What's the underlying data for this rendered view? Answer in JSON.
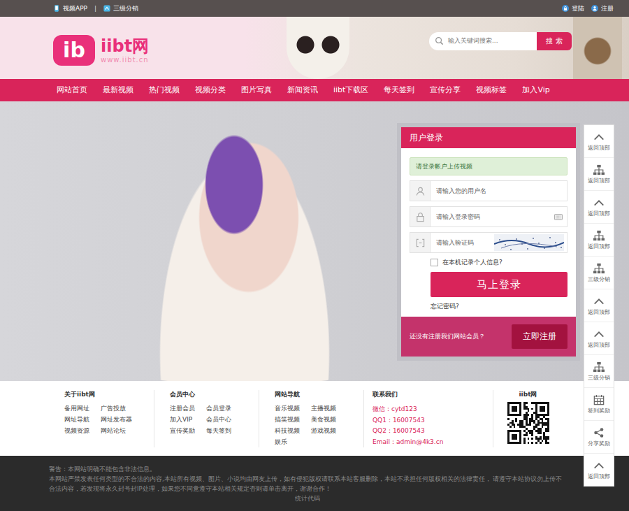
{
  "topbar": {
    "left": [
      {
        "label": "视频APP"
      },
      {
        "label": "三级分销"
      }
    ],
    "separator": "|",
    "right": [
      {
        "label": "登陆"
      },
      {
        "label": "注册"
      }
    ]
  },
  "logo": {
    "mark": "ib",
    "name": "iibt网",
    "url": "www.iibt.cn"
  },
  "search": {
    "placeholder": "输入关键词搜索...",
    "button": "搜 索"
  },
  "nav": [
    {
      "label": "网站首页",
      "selected": false
    },
    {
      "label": "最新视频",
      "selected": false
    },
    {
      "label": "热门视频",
      "selected": false
    },
    {
      "label": "视频分类",
      "selected": false
    },
    {
      "label": "图片写真",
      "selected": false
    },
    {
      "label": "新闻资讯",
      "selected": false
    },
    {
      "label": "iibt下载区",
      "selected": false
    },
    {
      "label": "每天签到",
      "selected": false
    },
    {
      "label": "宣传分享",
      "selected": false
    },
    {
      "label": "视频标签",
      "selected": false
    },
    {
      "label": "加入Vip",
      "selected": false
    }
  ],
  "login": {
    "title": "用户登录",
    "notice": "请登录帐户上传视频",
    "fields": [
      {
        "kind": "text",
        "placeholder": "请输入您的用户名"
      },
      {
        "kind": "password",
        "placeholder": "请输入登录密码"
      },
      {
        "kind": "captcha",
        "placeholder": "请输入验证码"
      }
    ],
    "remember": {
      "label": "在本机记录个人信息?",
      "checked": false
    },
    "submit": "马上登录",
    "forgot": "忘记密码?",
    "register_prompt": "还没有注册我们网站会员？",
    "register_button": "立即注册"
  },
  "sidebar": [
    {
      "kind": "top",
      "label": "返回顶部"
    },
    {
      "kind": "tree",
      "label": "返回顶部"
    },
    {
      "kind": "top",
      "label": "返回顶部"
    },
    {
      "kind": "tree",
      "label": "返回顶部"
    },
    {
      "kind": "tree",
      "label": "三级分销"
    },
    {
      "kind": "top",
      "label": "返回顶部"
    },
    {
      "kind": "top",
      "label": "返回顶部"
    },
    {
      "kind": "tree",
      "label": "三级分销"
    },
    {
      "kind": "calendar",
      "label": "签到奖励"
    },
    {
      "kind": "share",
      "label": "分享奖励"
    },
    {
      "kind": "top",
      "label": "返回顶部"
    }
  ],
  "footer": {
    "columns": [
      {
        "title": "关于iibt网",
        "links": [
          "备用网址",
          "广告投放",
          "网址导航",
          "网址发布器",
          "视频资源",
          "网站论坛"
        ]
      },
      {
        "title": "会员中心",
        "links": [
          "注册会员",
          "会员登录",
          "加入VIP",
          "会员中心",
          "宣传奖励",
          "每天签到"
        ]
      },
      {
        "title": "网站导航",
        "links": [
          "音乐视频",
          "主播视频",
          "搞笑视频",
          "美食视频",
          "科技视频",
          "游戏视频",
          "娱乐"
        ]
      }
    ],
    "contact": {
      "title": "联系我们",
      "lines": [
        "微信：cytd123",
        "QQ1：16007543",
        "QQ2：16007543",
        "Email：admin@4k3.cn"
      ]
    },
    "qr": {
      "title": "iibt网"
    }
  },
  "legal": {
    "lines": [
      "警告：本网站明确不能包含非法信息。",
      "本网站严禁发表任何类型的不合法的内容,本站所有视频、图片、小说均由网友上传，如有侵犯版权请联系本站客服删除，本站不承担任何版权相关的法律责任， 请遵守本站协议勿上传不合法内容，若发现将永久封号封IP处理，如果您不同意遵守本站相关规定否则请单击离开，谢谢合作！"
    ],
    "stats": "统计代码"
  }
}
